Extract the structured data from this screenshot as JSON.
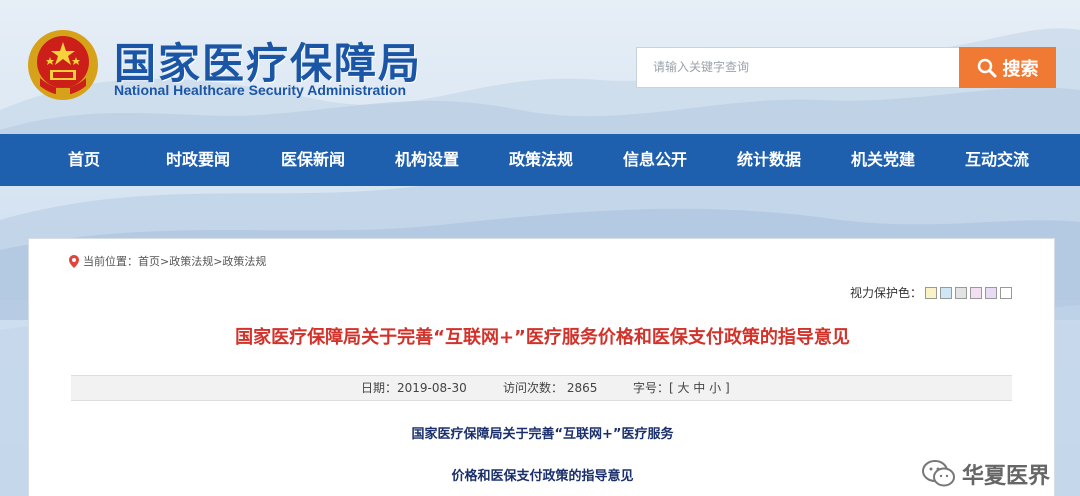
{
  "header": {
    "title": "国家医疗保障局",
    "subtitle": "National Healthcare Security Administration",
    "search_placeholder": "请输入关键字查询",
    "search_button": "搜索"
  },
  "nav": {
    "items": [
      "首页",
      "时政要闻",
      "医保新闻",
      "机构设置",
      "政策法规",
      "信息公开",
      "统计数据",
      "机关党建",
      "互动交流"
    ]
  },
  "breadcrumb": "当前位置：首页>政策法规>政策法规",
  "eye_care": {
    "label": "视力保护色：",
    "colors": [
      "#fbf3c4",
      "#cfe6f7",
      "#e3e3e3",
      "#f2dff0",
      "#e7dcf3",
      "#ffffff"
    ]
  },
  "article": {
    "title": "国家医疗保障局关于完善“互联网+”医疗服务价格和医保支付政策的指导意见",
    "date": "日期：2019-08-30",
    "visits": "访问次数： 2865",
    "font_size": "字号：[ 大 中 小 ]",
    "body_lines": [
      "国家医疗保障局关于完善“互联网+”医疗服务",
      "价格和医保支付政策的指导意见"
    ]
  },
  "watermark": "华夏医界",
  "colors": {
    "brand_blue": "#1e5fae",
    "title_red": "#d2322a",
    "search_orange": "#f07a34"
  }
}
